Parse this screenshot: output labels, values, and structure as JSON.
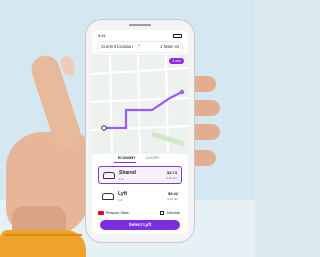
{
  "status": {
    "time": "9:41"
  },
  "route": {
    "from": "Current location",
    "to": "1 Main St"
  },
  "map": {
    "eta_label": "3 min",
    "route_color": "#9b59ff"
  },
  "tabs": {
    "economy": "ECONOMY",
    "luxury": "LUXURY"
  },
  "options": [
    {
      "name": "Shared",
      "sub": "1-2",
      "price": "$4.74",
      "eta": "3:15 pm"
    },
    {
      "name": "Lyft",
      "sub": "1-4",
      "price": "$9.42",
      "eta": "3:12 pm"
    }
  ],
  "payment": {
    "card_label": "Personal • Bank",
    "schedule_label": "Schedule"
  },
  "cta": {
    "label": "Select Lyft"
  },
  "colors": {
    "accent": "#7b2fe0",
    "skin": "#e7b597",
    "sleeve": "#f0a32a"
  }
}
